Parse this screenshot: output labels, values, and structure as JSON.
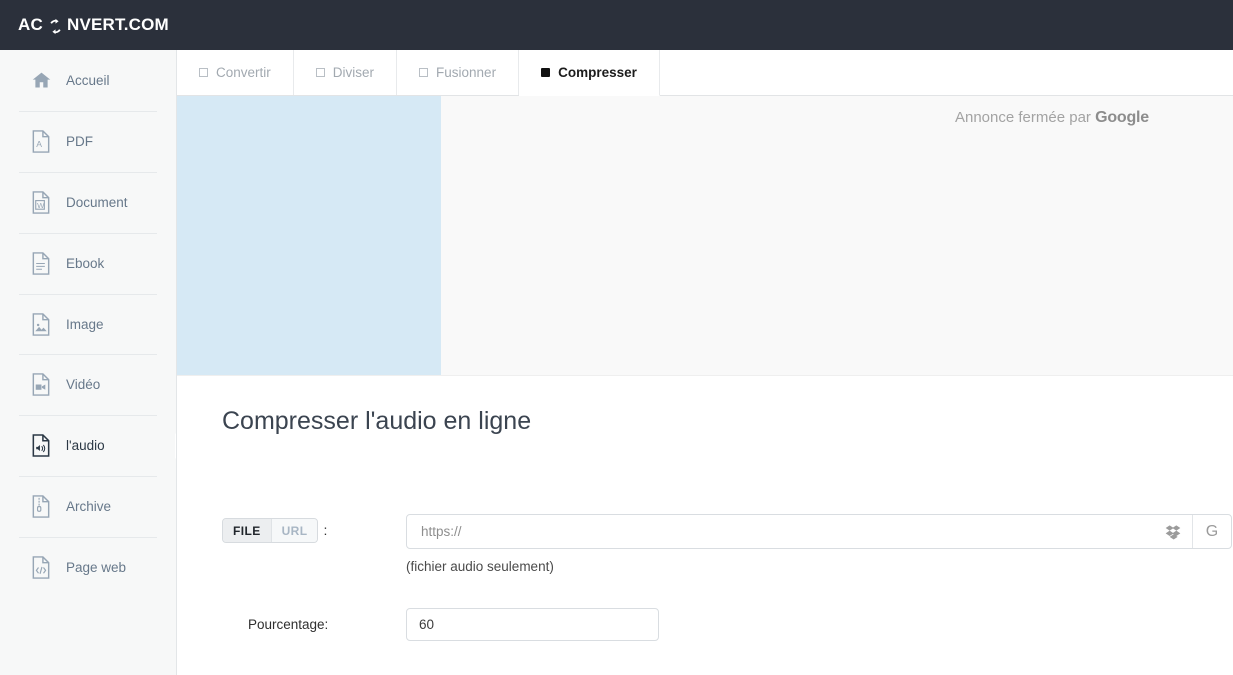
{
  "header": {
    "logo_prefix": "AC",
    "logo_suffix": "NVERT.COM",
    "logo_icon": "convert-circular-arrows-icon",
    "background_color": "#2b303b"
  },
  "sidebar": {
    "items": [
      {
        "label": "Accueil",
        "icon": "home-icon",
        "active": false
      },
      {
        "label": "PDF",
        "icon": "pdf-file-icon",
        "active": false
      },
      {
        "label": "Document",
        "icon": "word-file-icon",
        "active": false
      },
      {
        "label": "Ebook",
        "icon": "ebook-file-icon",
        "active": false
      },
      {
        "label": "Image",
        "icon": "image-file-icon",
        "active": false
      },
      {
        "label": "Vidéo",
        "icon": "video-file-icon",
        "active": false
      },
      {
        "label": "l'audio",
        "icon": "audio-file-icon",
        "active": true
      },
      {
        "label": "Archive",
        "icon": "archive-file-icon",
        "active": false
      },
      {
        "label": "Page web",
        "icon": "code-file-icon",
        "active": false
      }
    ]
  },
  "tabs": [
    {
      "label": "Convertir",
      "active": false
    },
    {
      "label": "Diviser",
      "active": false
    },
    {
      "label": "Fusionner",
      "active": false
    },
    {
      "label": "Compresser",
      "active": true
    }
  ],
  "ad": {
    "notice_text": "Annonce fermée par ",
    "notice_brand": "Google",
    "placeholder_color": "#d6e9f5",
    "background_color": "#f9f9f9"
  },
  "main": {
    "title": "Compresser l'audio en ligne",
    "source_row": {
      "segment_file": "FILE",
      "segment_url": "URL",
      "colon": ":",
      "input_placeholder": "https://",
      "input_value": "",
      "dropbox_icon": "dropbox-icon",
      "google_drive_icon": "google-drive-icon",
      "helper_text": "(fichier audio seulement)"
    },
    "percentage_row": {
      "label": "Pourcentage:",
      "value": "60"
    }
  }
}
